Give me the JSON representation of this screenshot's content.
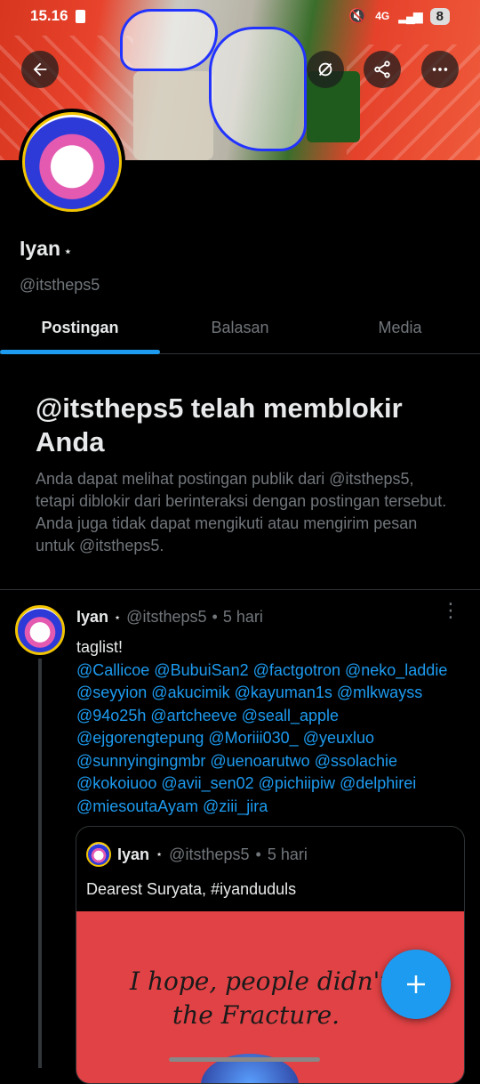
{
  "status_bar": {
    "time": "15.16",
    "network": "4G",
    "battery": "8"
  },
  "profile": {
    "name": "Iyan",
    "badge": "⋆",
    "handle": "@itstheps5"
  },
  "tabs": [
    {
      "label": "Postingan",
      "active": true
    },
    {
      "label": "Balasan",
      "active": false
    },
    {
      "label": "Media",
      "active": false
    }
  ],
  "blocked": {
    "title": "@itstheps5 telah memblokir Anda",
    "message": "Anda dapat melihat postingan publik dari @itstheps5, tetapi diblokir dari berinteraksi dengan postingan tersebut. Anda juga tidak dapat mengikuti atau mengirim pesan untuk @itstheps5."
  },
  "post": {
    "name": "Iyan",
    "badge": "⋆",
    "handle": "@itstheps5",
    "sep": "•",
    "time": "5 hari",
    "text": "taglist!",
    "mentions": [
      "@Callicoe @BubuiSan2 @factgotron @neko_laddie",
      "@seyyion @akucimik @kayuman1s @mlkwayss",
      "@94o25h @artcheeve @seall_apple",
      "@ejgorengtepung @Moriii030_ @yeuxluo",
      "@sunnyingingmbr @uenoarutwo @ssolachie",
      "@kokoiuoo @avii_sen02 @pichiipiw @delphirei",
      "@miesoutaAyam @ziii_jira"
    ]
  },
  "quote": {
    "name": "Iyan",
    "badge": "⋆",
    "handle": "@itstheps5",
    "sep": "•",
    "time": "5 hari",
    "text": "Dearest Suryata, #iyanduduls",
    "image_text_line1": "I hope, people didn't s",
    "image_text_line2": "the Fracture."
  },
  "icons": {
    "back": "arrow-left-icon",
    "hide": "eye-off-icon",
    "share": "share-icon",
    "more": "more-horizontal-icon",
    "compose": "plus-icon"
  },
  "colors": {
    "accent": "#1d9bf0",
    "muted": "#71767b",
    "background": "#000000"
  }
}
